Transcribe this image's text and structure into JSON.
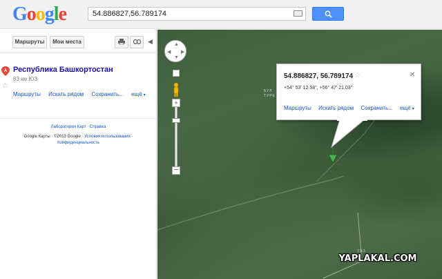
{
  "header": {
    "logo_text": "Google",
    "search_value": "54.886827,56.789174"
  },
  "toolbar": {
    "routes_label": "Маршруты",
    "my_places_label": "Мои места"
  },
  "place": {
    "title": "Республика Башкортостан",
    "subtitle": "83 км ЮЗ",
    "links": [
      "Маршруты",
      "Искать рядом",
      "Сохранить...",
      "ещё"
    ]
  },
  "footer": {
    "links": "Лаборатория Карт · Справка",
    "copyright": "Google Карты · ©2013 Google ·",
    "terms": "Условия использования",
    "privacy": "Конфиденциальность"
  },
  "bubble": {
    "title": "54.886827, 56.789174",
    "coords": "+54° 53' 12.58\", +56° 47' 21.03\"",
    "links": [
      "Маршруты",
      "Искать рядом",
      "Сохранить...",
      "ещё"
    ]
  },
  "map": {
    "label_1": "БУЛ",
    "label_2": "ТУРЕ",
    "label_3": "ГАЗ"
  },
  "watermark": "YAPLAKAL.COM",
  "colors": {
    "accent": "#4d90fe",
    "link": "#1155cc"
  }
}
